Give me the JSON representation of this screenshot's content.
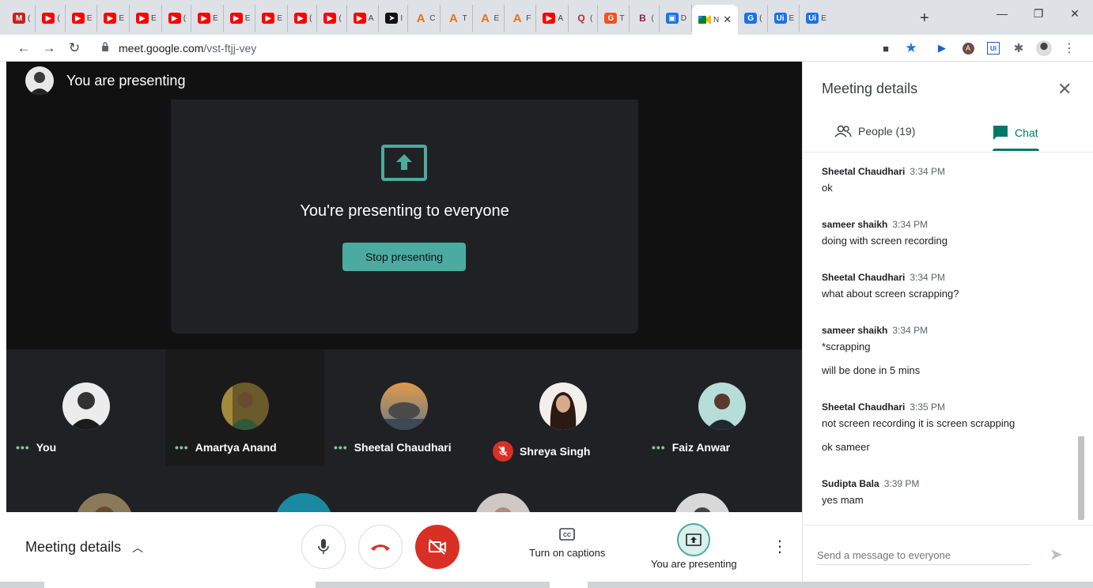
{
  "browser": {
    "tabs": [
      {
        "icon": "gmail-icon",
        "label": "(",
        "color": "#c5221f",
        "glyph": "M"
      },
      {
        "icon": "youtube-icon",
        "label": "(",
        "color": "#ff0000",
        "glyph": "▶"
      },
      {
        "icon": "youtube-icon",
        "label": "E",
        "color": "#ff0000",
        "glyph": "▶"
      },
      {
        "icon": "youtube-icon",
        "label": "E",
        "color": "#ff0000",
        "glyph": "▶"
      },
      {
        "icon": "youtube-icon",
        "label": "E",
        "color": "#ff0000",
        "glyph": "▶"
      },
      {
        "icon": "youtube-icon",
        "label": "(",
        "color": "#ff0000",
        "glyph": "▶"
      },
      {
        "icon": "youtube-icon",
        "label": "E",
        "color": "#ff0000",
        "glyph": "▶"
      },
      {
        "icon": "youtube-icon",
        "label": "E",
        "color": "#ff0000",
        "glyph": "▶"
      },
      {
        "icon": "youtube-icon",
        "label": "E",
        "color": "#ff0000",
        "glyph": "▶"
      },
      {
        "icon": "youtube-icon",
        "label": "(",
        "color": "#ff0000",
        "glyph": "▶"
      },
      {
        "icon": "youtube-icon",
        "label": "(",
        "color": "#ff0000",
        "glyph": "▶"
      },
      {
        "icon": "youtube-icon",
        "label": "A",
        "color": "#ff0000",
        "glyph": "▶"
      },
      {
        "icon": "arrow-ext-icon",
        "label": "I",
        "color": "#111111",
        "glyph": "➤"
      },
      {
        "icon": "a-logo-icon",
        "label": "C",
        "color": "#ffffff",
        "glyph": "A"
      },
      {
        "icon": "a-logo-icon",
        "label": "T",
        "color": "#ffffff",
        "glyph": "A"
      },
      {
        "icon": "a-logo-icon",
        "label": "E",
        "color": "#ffffff",
        "glyph": "A"
      },
      {
        "icon": "a-logo-icon",
        "label": "F",
        "color": "#ffffff",
        "glyph": "A"
      },
      {
        "icon": "youtube-icon",
        "label": "A",
        "color": "#ff0000",
        "glyph": "▶"
      },
      {
        "icon": "quora-icon",
        "label": "(",
        "color": "#ffffff",
        "glyph": "Q"
      },
      {
        "icon": "orange-logo-icon",
        "label": "T",
        "color": "#f4511e",
        "glyph": "G"
      },
      {
        "icon": "b-logo-icon",
        "label": "(",
        "color": "#ffffff",
        "glyph": "B"
      },
      {
        "icon": "contacts-icon",
        "label": "D",
        "color": "#1a73e8",
        "glyph": "▣"
      }
    ],
    "active_tab": {
      "icon": "meet-icon",
      "label": "N"
    },
    "trailing_tabs": [
      {
        "icon": "gsuite-icon",
        "label": "(",
        "color": "#1a73e8",
        "glyph": "G"
      },
      {
        "icon": "uipath-icon",
        "label": "E",
        "color": "#1a73e8",
        "glyph": "Ui"
      },
      {
        "icon": "uipath-icon",
        "label": "E",
        "color": "#1a73e8",
        "glyph": "Ui"
      }
    ],
    "url_host": "meet.google.com",
    "url_path": "/vst-ftjj-vey"
  },
  "meet": {
    "presenting_header": "You are presenting",
    "presenting_message": "You're presenting to everyone",
    "stop_button": "Stop presenting",
    "participants": [
      {
        "name": "You",
        "muted": false
      },
      {
        "name": "Amartya Anand",
        "muted": false
      },
      {
        "name": "Sheetal Chaudhari",
        "muted": false
      },
      {
        "name": "Shreya Singh",
        "muted": true
      },
      {
        "name": "Faiz Anwar",
        "muted": false
      }
    ],
    "bottom": {
      "meeting_details": "Meeting details",
      "captions_label": "Turn on captions",
      "presenting_label": "You are presenting"
    }
  },
  "panel": {
    "title": "Meeting details",
    "people_tab": "People (19)",
    "chat_tab": "Chat",
    "messages": [
      {
        "sender": "Sheetal Chaudhari",
        "time": "3:34 PM",
        "lines": [
          "ok"
        ]
      },
      {
        "sender": "sameer shaikh",
        "time": "3:34 PM",
        "lines": [
          "doing with screen recording"
        ]
      },
      {
        "sender": "Sheetal Chaudhari",
        "time": "3:34 PM",
        "lines": [
          "what about screen scrapping?"
        ]
      },
      {
        "sender": "sameer shaikh",
        "time": "3:34 PM",
        "lines": [
          "*scrapping",
          "will be done in 5 mins"
        ]
      },
      {
        "sender": "Sheetal Chaudhari",
        "time": "3:35 PM",
        "lines": [
          "not screen recording it is screen scrapping",
          "ok sameer"
        ]
      },
      {
        "sender": "Sudipta Bala",
        "time": "3:39 PM",
        "lines": [
          "yes mam"
        ]
      }
    ],
    "send_placeholder": "Send a message to everyone"
  },
  "colors": {
    "accent_teal": "#4caba0",
    "chat_green": "#00796b",
    "danger_red": "#d93025",
    "stage_dark": "#202124"
  }
}
